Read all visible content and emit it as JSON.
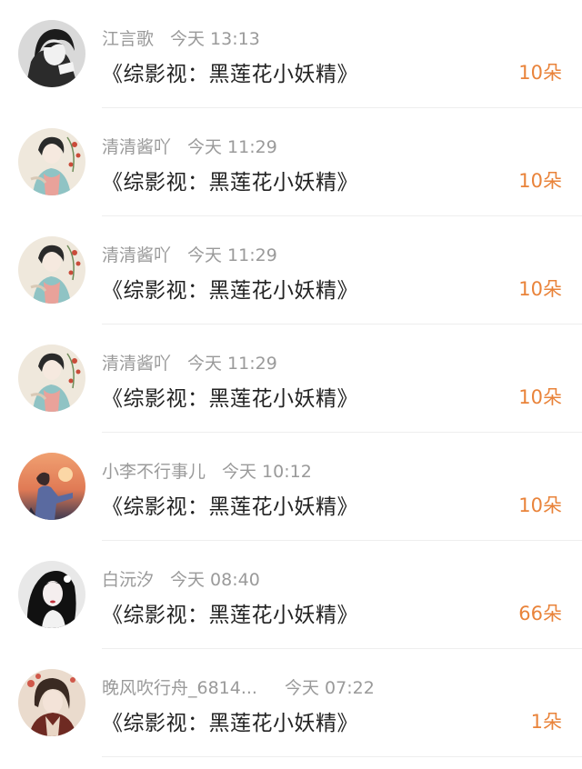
{
  "colors": {
    "username": "#9a9a9a",
    "title": "#222222",
    "count": "#e9833a",
    "divider": "#eeeeee"
  },
  "gifts": [
    {
      "user": "江言歌",
      "time": "今天 13:13",
      "title": "《综影视：黑莲花小妖精》",
      "count": "10朵",
      "avatar_icon": "anime-boy-avatar-icon"
    },
    {
      "user": "清清酱吖",
      "time": "今天 11:29",
      "title": "《综影视：黑莲花小妖精》",
      "count": "10朵",
      "avatar_icon": "ancient-lady-avatar-icon"
    },
    {
      "user": "清清酱吖",
      "time": "今天 11:29",
      "title": "《综影视：黑莲花小妖精》",
      "count": "10朵",
      "avatar_icon": "ancient-lady-avatar-icon"
    },
    {
      "user": "清清酱吖",
      "time": "今天 11:29",
      "title": "《综影视：黑莲花小妖精》",
      "count": "10朵",
      "avatar_icon": "ancient-lady-avatar-icon"
    },
    {
      "user": "小李不行事儿",
      "time": "今天 10:12",
      "title": "《综影视：黑莲花小妖精》",
      "count": "10朵",
      "avatar_icon": "sunset-figure-avatar-icon"
    },
    {
      "user": "白沅汐",
      "time": "今天 08:40",
      "title": "《综影视：黑莲花小妖精》",
      "count": "66朵",
      "avatar_icon": "dark-hair-girl-avatar-icon"
    },
    {
      "user": "晚风吹行舟_6814...",
      "time": "今天 07:22",
      "title": "《综影视：黑莲花小妖精》",
      "count": "1朵",
      "avatar_icon": "ancient-man-avatar-icon"
    }
  ]
}
